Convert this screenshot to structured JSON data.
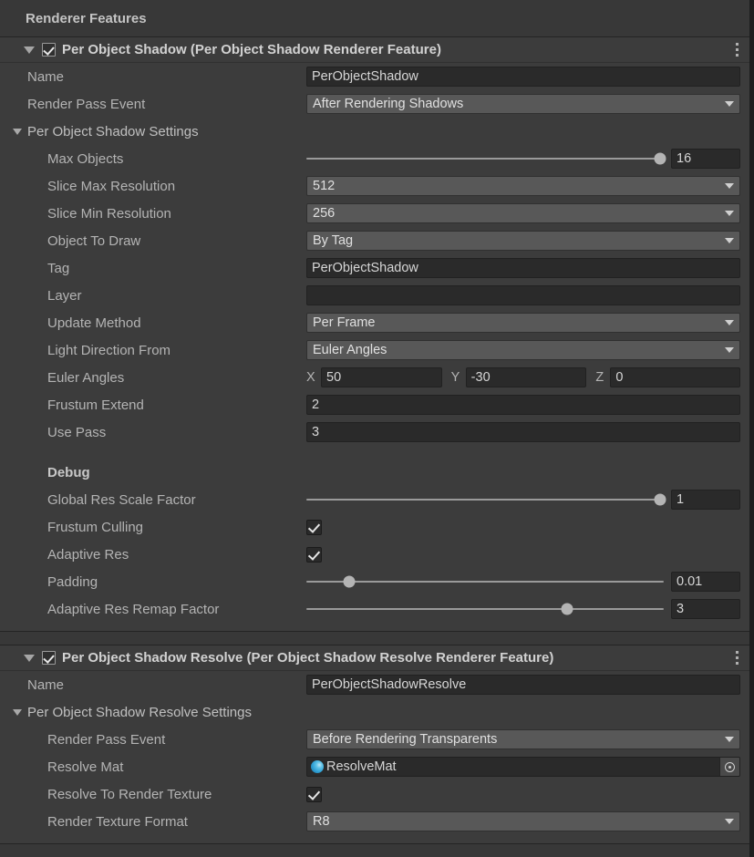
{
  "panel": {
    "section_title": "Renderer Features"
  },
  "features": [
    {
      "header_title": "Per Object Shadow (Per Object Shadow Renderer Feature)",
      "enabled": true,
      "expanded": true,
      "menu_icon": "kebab-menu-icon",
      "name_label": "Name",
      "name_value": "PerObjectShadow",
      "render_pass_event_label": "Render Pass Event",
      "render_pass_event_value": "After Rendering Shadows",
      "settings_group_label": "Per Object Shadow Settings",
      "rows": {
        "max_objects": {
          "label": "Max Objects",
          "value": "16",
          "slider_pct": 99
        },
        "slice_max_resolution": {
          "label": "Slice Max Resolution",
          "value": "512"
        },
        "slice_min_resolution": {
          "label": "Slice Min Resolution",
          "value": "256"
        },
        "object_to_draw": {
          "label": "Object To Draw",
          "value": "By Tag"
        },
        "tag": {
          "label": "Tag",
          "value": "PerObjectShadow"
        },
        "layer": {
          "label": "Layer",
          "value": ""
        },
        "update_method": {
          "label": "Update Method",
          "value": "Per Frame"
        },
        "light_direction_from": {
          "label": "Light Direction From",
          "value": "Euler Angles"
        },
        "euler_angles": {
          "label": "Euler Angles",
          "axis_x": "X",
          "x": "50",
          "axis_y": "Y",
          "y": "-30",
          "axis_z": "Z",
          "z": "0"
        },
        "frustum_extend": {
          "label": "Frustum Extend",
          "value": "2"
        },
        "use_pass": {
          "label": "Use Pass",
          "value": "3"
        }
      },
      "debug": {
        "label": "Debug",
        "global_res_scale_factor": {
          "label": "Global Res Scale Factor",
          "value": "1",
          "slider_pct": 99
        },
        "frustum_culling": {
          "label": "Frustum Culling",
          "checked": true
        },
        "adaptive_res": {
          "label": "Adaptive Res",
          "checked": true
        },
        "padding": {
          "label": "Padding",
          "value": "0.01",
          "slider_pct": 12
        },
        "adaptive_res_remap_factor": {
          "label": "Adaptive Res Remap Factor",
          "value": "3",
          "slider_pct": 73
        }
      }
    },
    {
      "header_title": "Per Object Shadow Resolve (Per Object Shadow Resolve Renderer Feature)",
      "enabled": true,
      "expanded": true,
      "menu_icon": "kebab-menu-icon",
      "name_label": "Name",
      "name_value": "PerObjectShadowResolve",
      "settings_group_label": "Per Object Shadow Resolve Settings",
      "rows": {
        "render_pass_event": {
          "label": "Render Pass Event",
          "value": "Before Rendering Transparents"
        },
        "resolve_mat": {
          "label": "Resolve Mat",
          "value": "ResolveMat",
          "icon": "material-sphere-icon",
          "picker_icon": "object-picker-icon"
        },
        "resolve_to_render_texture": {
          "label": "Resolve To Render Texture",
          "checked": true
        },
        "render_texture_format": {
          "label": "Render Texture Format",
          "value": "R8"
        }
      }
    }
  ],
  "colors": {
    "background": "#383838",
    "card": "#3c3c3c",
    "dropdown": "#585858",
    "field": "#2a2a2a",
    "text": "#b4b4b4",
    "accent_material": "#3fa9dd"
  }
}
